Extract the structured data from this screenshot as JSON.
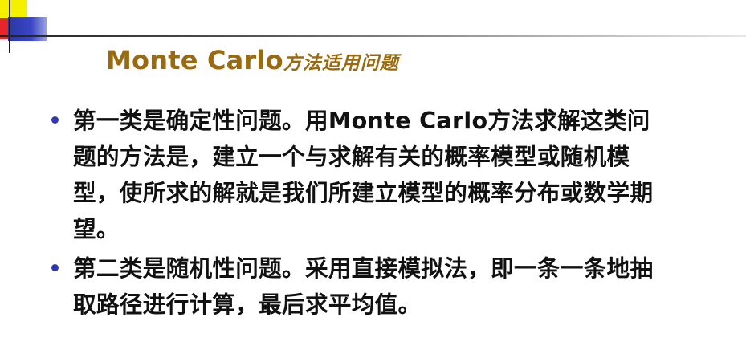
{
  "slide": {
    "title_latin": "Monte Carlo",
    "title_cn": "方法适用问题",
    "bullets": [
      {
        "text": "第一类是确定性问题。用Monte Carlo方法求解这类问题的方法是，建立一个与求解有关的概率模型或随机模型，使所求的解就是我们所建立模型的概率分布或数学期望。"
      },
      {
        "text": "第二类是随机性问题。采用直接模拟法，即一条一条地抽取路径进行计算，最后求平均值。"
      }
    ]
  },
  "colors": {
    "title": "#9a6a0e",
    "bullet_dot": "#3037b2",
    "accent_yellow": "#f5f000",
    "accent_red": "#e8262a",
    "accent_blue": "#2b36a8"
  }
}
